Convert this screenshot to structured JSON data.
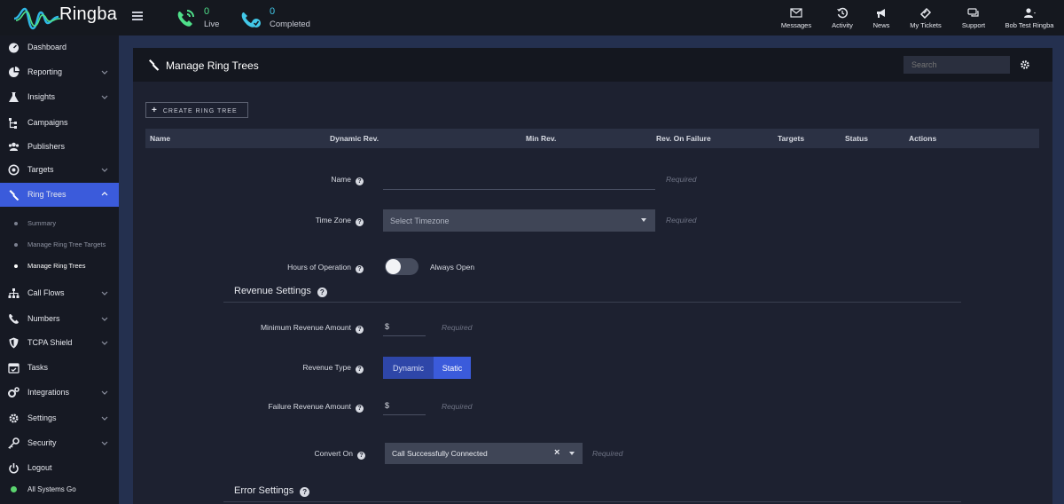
{
  "app": {
    "name": "Ringba"
  },
  "header": {
    "live": {
      "count": "0",
      "label": "Live"
    },
    "completed": {
      "count": "0",
      "label": "Completed"
    },
    "nav": [
      {
        "label": "Messages",
        "icon": "envelope-icon"
      },
      {
        "label": "Activity",
        "icon": "history-icon"
      },
      {
        "label": "News",
        "icon": "megaphone-icon"
      },
      {
        "label": "My Tickets",
        "icon": "ticket-icon"
      },
      {
        "label": "Support",
        "icon": "chat-icon"
      },
      {
        "label": "Bob Test Ringba",
        "icon": "user-icon"
      }
    ]
  },
  "sidebar": {
    "items": [
      {
        "label": "Dashboard"
      },
      {
        "label": "Reporting"
      },
      {
        "label": "Insights"
      },
      {
        "label": "Campaigns"
      },
      {
        "label": "Publishers"
      },
      {
        "label": "Targets"
      },
      {
        "label": "Ring Trees"
      },
      {
        "label": "Call Flows"
      },
      {
        "label": "Numbers"
      },
      {
        "label": "TCPA Shield"
      },
      {
        "label": "Tasks"
      },
      {
        "label": "Integrations"
      },
      {
        "label": "Settings"
      },
      {
        "label": "Security"
      },
      {
        "label": "Logout"
      },
      {
        "label": "All Systems Go"
      }
    ],
    "sub_items": [
      {
        "label": "Summary"
      },
      {
        "label": "Manage Ring Tree Targets"
      },
      {
        "label": "Manage Ring Trees"
      }
    ]
  },
  "page": {
    "title": "Manage Ring Trees",
    "search_placeholder": "Search",
    "create_button": "CREATE RING TREE",
    "columns": [
      "Name",
      "Dynamic Rev.",
      "Min Rev.",
      "Rev. On Failure",
      "Targets",
      "Status",
      "Actions"
    ]
  },
  "form": {
    "name_label": "Name",
    "time_zone_label": "Time Zone",
    "time_zone_value": "Select Timezone",
    "hours_label": "Hours of Operation",
    "hours_value": "Always Open",
    "required": "Required",
    "revenue_settings": "Revenue Settings",
    "min_revenue_label": "Minimum Revenue Amount",
    "currency": "$",
    "revenue_type_label": "Revenue Type",
    "revenue_type_options": [
      "Dynamic",
      "Static"
    ],
    "failure_revenue_label": "Failure Revenue Amount",
    "convert_on_label": "Convert On",
    "convert_on_value": "Call Successfully Connected",
    "error_settings": "Error Settings"
  },
  "colors": {
    "accent": "#3b5bdb",
    "live": "#4fe08a",
    "completed": "#42c8e8",
    "status_ok": "#5bd46f"
  }
}
